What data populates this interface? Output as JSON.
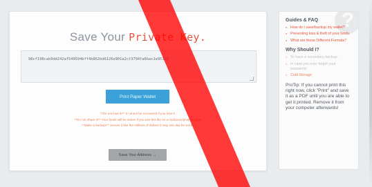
{
  "main": {
    "title_prefix": "Save Your",
    "title_highlight": "Private Key.",
    "private_key": "98cf198cab9dd242af549594bff4b862bd6126e901a2cf3794fa6bac1e951b2",
    "print_button": "Print Paper Wallet",
    "warnings": [
      "**Do not lose it!** It cannot be recovered if you lose it.",
      "**Do not share it!** Your funds will be stolen if you use this file on a malicious/phishing site.",
      "**Make a backup!** Secure it like the millions of dollars it may one day be worth."
    ],
    "save_button": "Save Your Address →"
  },
  "sidebar": {
    "heading": "Guides & FAQ",
    "guides": [
      "How do I save/backup my wallet?",
      "Preventing loss & theft of your funds.",
      "What are these Different Formats?"
    ],
    "why_heading": "Why Should I?",
    "why_items": [
      "To have a secondary backup.",
      "In case you ever forget your password.",
      "Cold Storage"
    ],
    "protip": "ProTip: If you cannot print this right now, click \"Print\" and save it as a PDF until you are able to get it printed. Remove it from your computer afterwards!",
    "help_icon": "question-mark-icon"
  },
  "colors": {
    "accent": "#e8513a",
    "print_button": "#3ca1d8",
    "save_button": "#a3a6a8",
    "overlay_stripe": "#ff0000"
  }
}
